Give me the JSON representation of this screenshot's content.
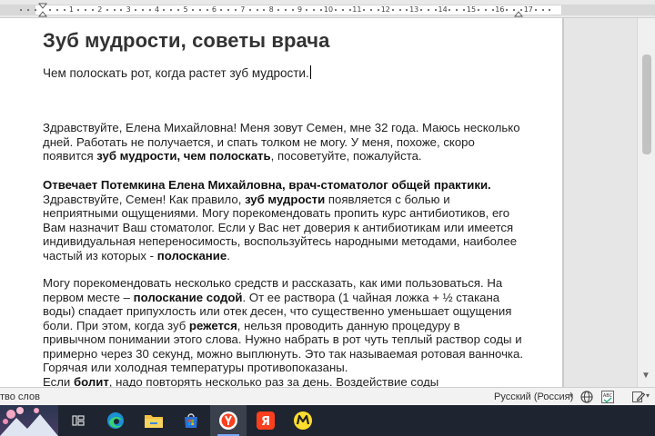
{
  "ruler": {
    "numbers": [
      "1",
      "2",
      "3",
      "4",
      "5",
      "6",
      "7",
      "8",
      "9",
      "10",
      "11",
      "12",
      "13",
      "14",
      "15",
      "16",
      "17"
    ]
  },
  "document": {
    "title": "Зуб мудрости, советы врача",
    "subtitle": "Чем полоскать рот, когда растет зуб мудрости.",
    "para1": [
      {
        "t": "Здравствуйте,  Елена Михайловна! Меня зовут Семен, мне 32 года. Маюсь несколько дней. Работать не получается, и спать толком не могу. У меня, похоже, скоро появится ",
        "b": false
      },
      {
        "t": "зуб мудрости, чем полоскать",
        "b": true
      },
      {
        "t": ", посоветуйте, пожалуйста.",
        "b": false
      }
    ],
    "para2": [
      {
        "t": "Отвечает Потемкина Елена Михайловна, врач-стоматолог общей практики.",
        "b": true,
        "br": true
      },
      {
        "t": "Здравствуйте, Семен! Как  правило, ",
        "b": false
      },
      {
        "t": "зуб мудрости",
        "b": true
      },
      {
        "t": " появляется с болью и неприятными ощущениями. Могу порекомендовать пропить курс антибиотиков, его Вам назначит Ваш  стоматолог. Если у Вас нет доверия  к антибиотикам или имеется индивидуальная непереносимость, воспользуйтесь народными методами, наиболее частый из которых - ",
        "b": false
      },
      {
        "t": "полоскание",
        "b": true
      },
      {
        "t": ".",
        "b": false
      }
    ],
    "para3": [
      {
        "t": "Могу порекомендовать несколько средств и рассказать, как ими пользоваться.  На первом месте – ",
        "b": false
      },
      {
        "t": "полоскание содой",
        "b": true
      },
      {
        "t": ". От ее раствора (1 чайная ложка + ½ стакана воды) спадает припухлость или отек десен, что существенно уменьшает ощущения боли. При этом, когда зуб ",
        "b": false
      },
      {
        "t": "режется",
        "b": true
      },
      {
        "t": ", нельзя проводить данную процедуру в привычном понимании этого слова. Нужно набрать в рот чуть теплый раствор соды и примерно через 30 секунд, можно выплюнуть. Это так называемая ротовая ванночка. Горячая или холодная температуры противопоказаны.",
        "b": false,
        "br": true
      },
      {
        "t": "Если ",
        "b": false
      },
      {
        "t": "болит",
        "b": true
      },
      {
        "t": ", надо повторять несколько раз за день. Воздействие соды",
        "b": false
      }
    ]
  },
  "statusbar": {
    "words": "тво слов",
    "language": "Русский (Россия)"
  },
  "taskbar": {
    "items": [
      "start-button",
      "task-view-icon",
      "edge-browser-icon",
      "file-explorer-icon",
      "microsoft-store-icon",
      "yandex-browser-icon",
      "yandex-icon",
      "yandex-market-icon"
    ]
  },
  "colors": {
    "accent": "#7aa9ff",
    "taskbar": "#1f2530",
    "yandex_red": "#fc3f1d"
  }
}
